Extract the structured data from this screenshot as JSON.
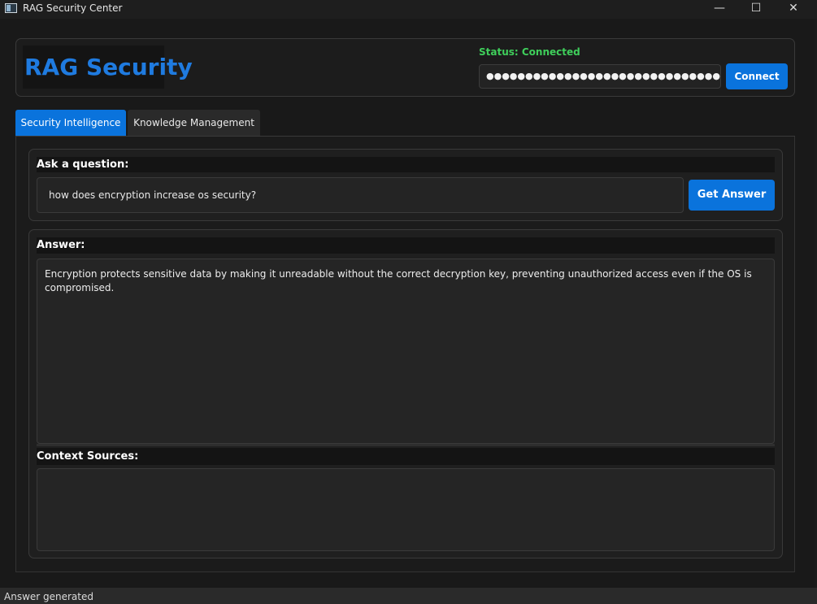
{
  "window": {
    "title": "RAG Security Center",
    "controls": {
      "minimize": "—",
      "maximize": "☐",
      "close": "✕"
    }
  },
  "header": {
    "logo_text": "RAG Security",
    "status_text": "Status: Connected",
    "api_key_masked": "●●●●●●●●●●●●●●●●●●●●●●●●●●●●●●●●●●●●●●●",
    "connect_label": "Connect"
  },
  "tabs": [
    {
      "label": "Security Intelligence",
      "active": true
    },
    {
      "label": "Knowledge Management",
      "active": false
    }
  ],
  "question": {
    "label": "Ask a question:",
    "value": "how does encryption increase os security?",
    "button_label": "Get Answer"
  },
  "answer": {
    "label": "Answer:",
    "text": "Encryption protects sensitive data by making it unreadable without the correct decryption key, preventing unauthorized access even if the OS is compromised."
  },
  "context": {
    "label": "Context Sources:",
    "text": ""
  },
  "statusbar": {
    "text": "Answer generated"
  },
  "colors": {
    "accent": "#0a73dc",
    "logo": "#1f7be0",
    "status_ok": "#3fcf5b",
    "background": "#1b1b1b"
  }
}
